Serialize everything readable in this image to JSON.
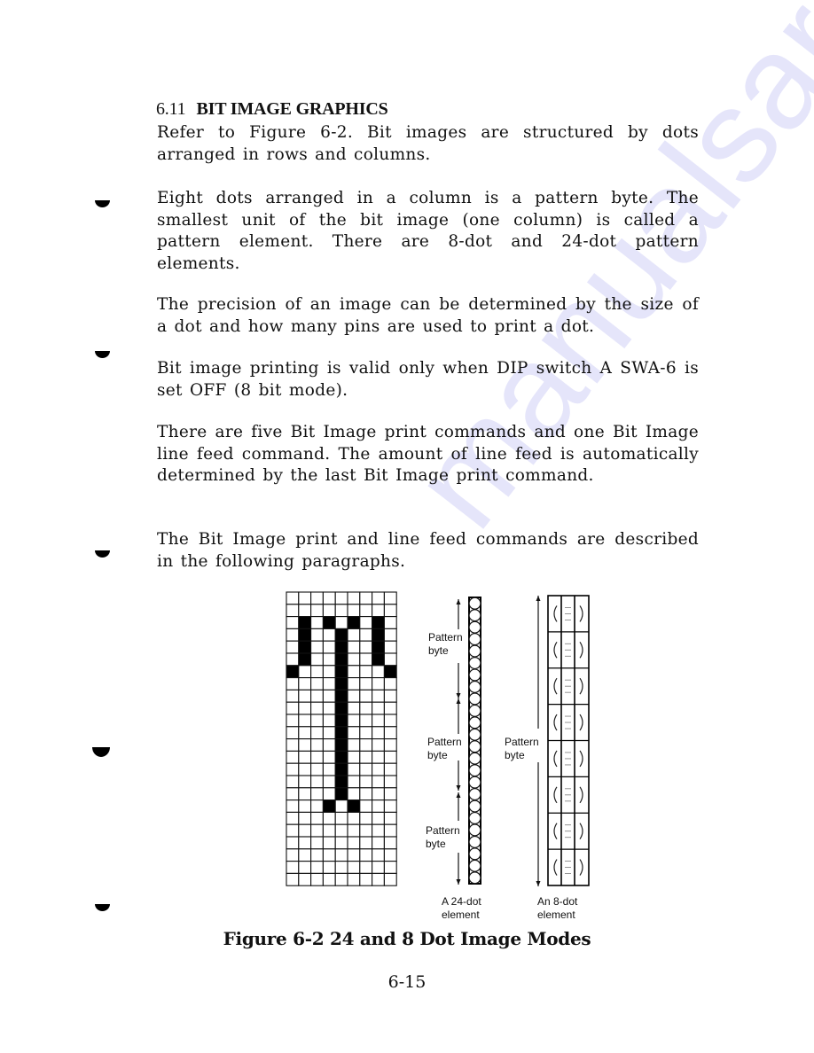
{
  "section": {
    "number": "6.11",
    "title": "BIT IMAGE GRAPHICS"
  },
  "paragraphs": [
    "Refer to Figure 6-2.  Bit images are structured by dots arranged in rows and columns.",
    "Eight dots arranged in a column is a pattern byte.  The smallest unit of the bit image (one column) is called a pattern element.  There are 8-dot and 24-dot pattern elements.",
    "The precision of an image can be determined by the size of a dot and how many pins are used to print a dot.",
    "Bit image printing is valid only when DIP switch A SWA-6 is set OFF (8 bit mode).",
    "There are five Bit Image print commands and one Bit Image line feed command.  The amount of line feed is automatically determined by the last Bit Image print command.",
    "The Bit Image print and line feed commands are described in the following paragraphs."
  ],
  "figure": {
    "grid": {
      "columns": 9,
      "rows": 24,
      "filled_cells": [
        [
          2,
          1
        ],
        [
          2,
          3
        ],
        [
          2,
          5
        ],
        [
          2,
          7
        ],
        [
          3,
          1
        ],
        [
          3,
          4
        ],
        [
          3,
          7
        ],
        [
          4,
          1
        ],
        [
          4,
          4
        ],
        [
          4,
          7
        ],
        [
          5,
          1
        ],
        [
          5,
          4
        ],
        [
          5,
          7
        ],
        [
          6,
          0
        ],
        [
          6,
          4
        ],
        [
          6,
          8
        ],
        [
          7,
          4
        ],
        [
          8,
          4
        ],
        [
          9,
          4
        ],
        [
          10,
          4
        ],
        [
          11,
          4
        ],
        [
          12,
          4
        ],
        [
          13,
          4
        ],
        [
          14,
          4
        ],
        [
          15,
          4
        ],
        [
          16,
          4
        ],
        [
          17,
          3
        ],
        [
          17,
          5
        ]
      ]
    },
    "element_24dot": {
      "dots": 24,
      "pattern_byte_labels": [
        "Pattern\nbyte",
        "Pattern\nbyte",
        "Pattern\nbyte"
      ],
      "caption_line1": "A 24-dot",
      "caption_line2": "element"
    },
    "element_8dot": {
      "dots": 8,
      "pattern_byte_label": "Pattern\nbyte",
      "caption_line1": "An 8-dot",
      "caption_line2": "element"
    },
    "caption": "Figure 6-2  24 and 8 Dot Image Modes"
  },
  "page_number": "6-15",
  "watermark": "manualsarchive.com"
}
